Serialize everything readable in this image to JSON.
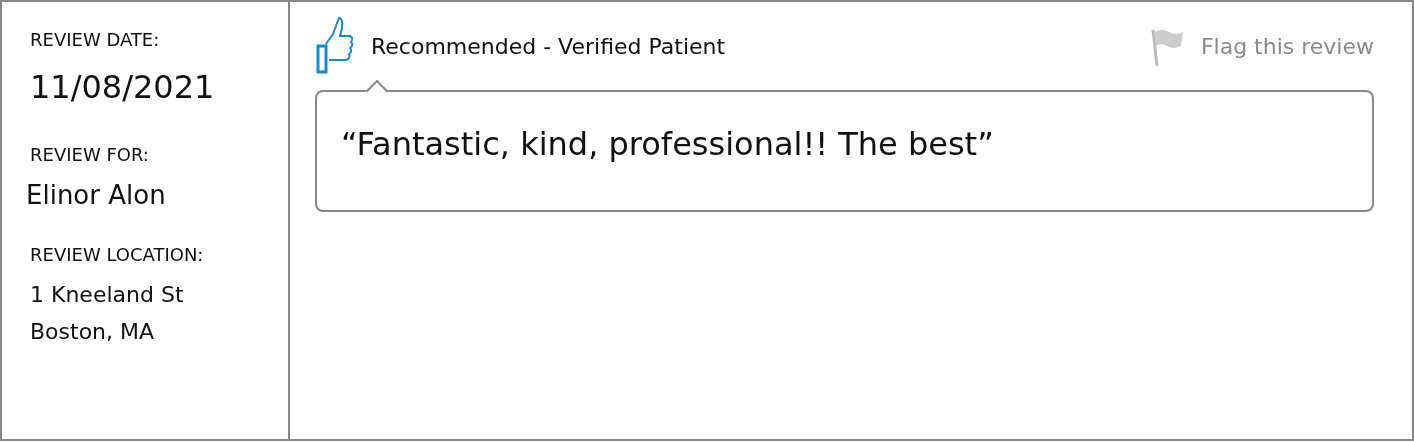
{
  "meta": [
    {
      "label": "REVIEW DATE:",
      "value": "11/08/2021",
      "kind": "date"
    },
    {
      "label": "REVIEW FOR:",
      "value": "Elinor Alon",
      "kind": "name"
    },
    {
      "label": "REVIEW LOCATION:",
      "value": "1 Kneeland St\nBoston, MA",
      "kind": "address"
    }
  ],
  "recommendation": {
    "recommended": true,
    "text": "Recommended - Verified Patient"
  },
  "flag_link": "Flag this review",
  "quote": "“Fantastic, kind, professional!! The best”"
}
